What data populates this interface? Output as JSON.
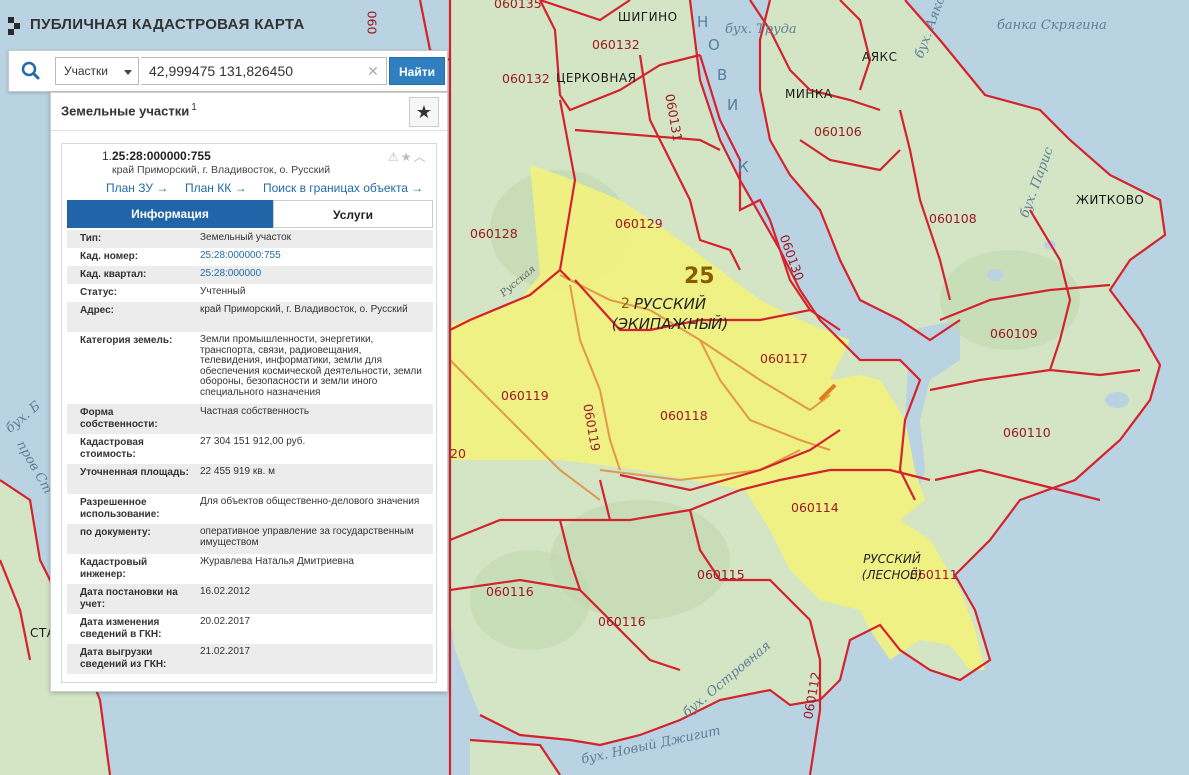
{
  "app": {
    "title": "ПУБЛИЧНАЯ КАДАСТРОВАЯ КАРТА"
  },
  "search": {
    "type_value": "Участки",
    "query": "42,999475 131,826450",
    "button_label": "Найти"
  },
  "panel": {
    "title": "Земельные участки",
    "count": "1",
    "item": {
      "number": "1.",
      "cad_number": "25:28:000000:755",
      "address": "край Приморский, г. Владивосток, о. Русский",
      "links": [
        "План ЗУ →",
        "План КК →",
        "Поиск в границах объекта →"
      ]
    },
    "tabs": [
      "Информация",
      "Услуги"
    ],
    "rows": [
      {
        "key": "Тип:",
        "value": "Земельный участок"
      },
      {
        "key": "Кад. номер:",
        "value": "25:28:000000:755"
      },
      {
        "key": "Кад. квартал:",
        "value": "25:28:000000"
      },
      {
        "key": "Статус:",
        "value": "Учтенный"
      },
      {
        "key": "Адрес:",
        "value": "край Приморский, г. Владивосток, о. Русский"
      },
      {
        "key": "Категория земель:",
        "value": "Земли промышленности, энергетики, транспорта, связи, радиовещания, телевидения, информатики, земли для обеспечения космической деятельности, земли обороны, безопасности и земли иного специального назначения"
      },
      {
        "key": "Форма собственности:",
        "value": "Частная собственность"
      },
      {
        "key": "Кадастровая стоимость:",
        "value": "27 304 151 912,00 руб."
      },
      {
        "key": "Уточненная площадь:",
        "value": "22 455 919 кв. м"
      },
      {
        "key": "Разрешенное использование:",
        "value": "Для объектов общественно-делового значения"
      },
      {
        "key": "по документу:",
        "value": "оперативное управление за государственным имуществом"
      },
      {
        "key": "Кадастровый инженер:",
        "value": "Журавлева Наталья Дмитриевна"
      },
      {
        "key": "Дата постановки на учет:",
        "value": "16.02.2012"
      },
      {
        "key": "Дата изменения сведений в ГКН:",
        "value": "20.02.2017"
      },
      {
        "key": "Дата выгрузки сведений из ГКН:",
        "value": "21.02.2017"
      }
    ]
  },
  "map": {
    "quarter_labels": [
      "060135",
      "060132",
      "060132",
      "060131",
      "060130",
      "060129",
      "060128",
      "060119",
      "060119",
      "060118",
      "060117",
      "060116",
      "060116",
      "060115",
      "060114",
      "060111",
      "060112",
      "060110",
      "060109",
      "060108",
      "060106",
      "060"
    ],
    "places": [
      "ШИГИНО",
      "ЦЕРКОВНАЯ",
      "МИНКА",
      "АЯКС",
      "ЖИТКОВО",
      "СТА"
    ],
    "island_name": "РУССКИЙ (ЭКИПАЖНЫЙ)",
    "island_name_line1": "РУССКИЙ",
    "island_name_line2": "(ЭКИПАЖНЫЙ)",
    "forest_name_line1": "РУССКИЙ",
    "forest_name_line2": "(ЛЕСНОЁ)",
    "district_marker": "25",
    "small_marker": "2",
    "strait_letters": [
      "Н",
      "О",
      "В",
      "И",
      "К"
    ],
    "water_labels": [
      "банка Скрягина",
      "бух. Труда",
      "бух. Аякс",
      "бух. Парис",
      "бух. Островная",
      "бух. Новый Джигит",
      "бух. Б",
      "пров Ст",
      "Русская",
      "20"
    ],
    "colors": {
      "land": "#cfe3c0",
      "water": "#b9d3e3",
      "boundary": "#d4222e",
      "parcel_fill": "#f4f37a",
      "road": "#e07a20"
    }
  }
}
